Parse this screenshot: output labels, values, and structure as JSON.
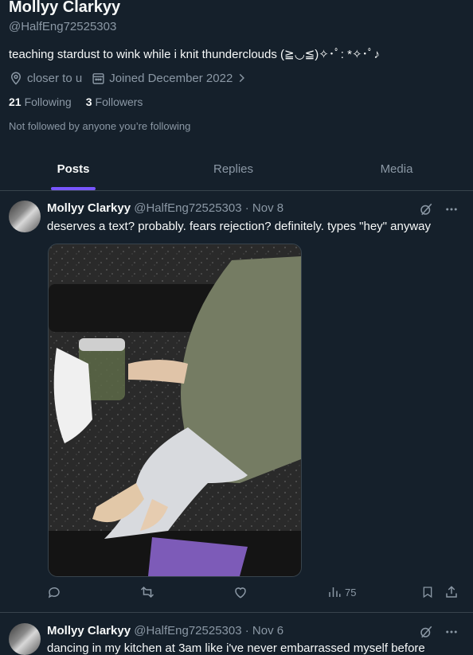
{
  "profile": {
    "display_name": "Mollyy Clarkyy",
    "handle": "@HalfEng72525303",
    "bio": "teaching stardust to wink while i knit thunderclouds (≧◡≦)✧･ﾟ: *✧･ﾟ♪",
    "location": "closer to u",
    "joined": "Joined December 2022",
    "following_count": "21",
    "following_label": "Following",
    "followers_count": "3",
    "followers_label": "Followers",
    "not_followed_text": "Not followed by anyone you’re following"
  },
  "tabs": [
    {
      "label": "Posts",
      "active": true
    },
    {
      "label": "Replies",
      "active": false
    },
    {
      "label": "Media",
      "active": false
    }
  ],
  "posts": [
    {
      "name": "Mollyy Clarkyy",
      "handle_date": "@HalfEng72525303 · Nov 8",
      "text": "deserves a text? probably. fears rejection? definitely. types \"hey\" anyway",
      "views": "75"
    },
    {
      "name": "Mollyy Clarkyy",
      "handle_date": "@HalfEng72525303 · Nov 6",
      "text": "dancing in my kitchen at 3am like i've never embarrassed myself before"
    }
  ],
  "colors": {
    "background": "#15202b",
    "accent": "#1d9bf0",
    "muted": "#8b98a5",
    "border": "#38444d"
  },
  "icons": [
    "location-icon",
    "calendar-icon",
    "chevron-right-icon",
    "grok-icon",
    "more-icon",
    "reply-icon",
    "repost-icon",
    "like-icon",
    "views-icon",
    "bookmark-icon",
    "share-icon"
  ]
}
